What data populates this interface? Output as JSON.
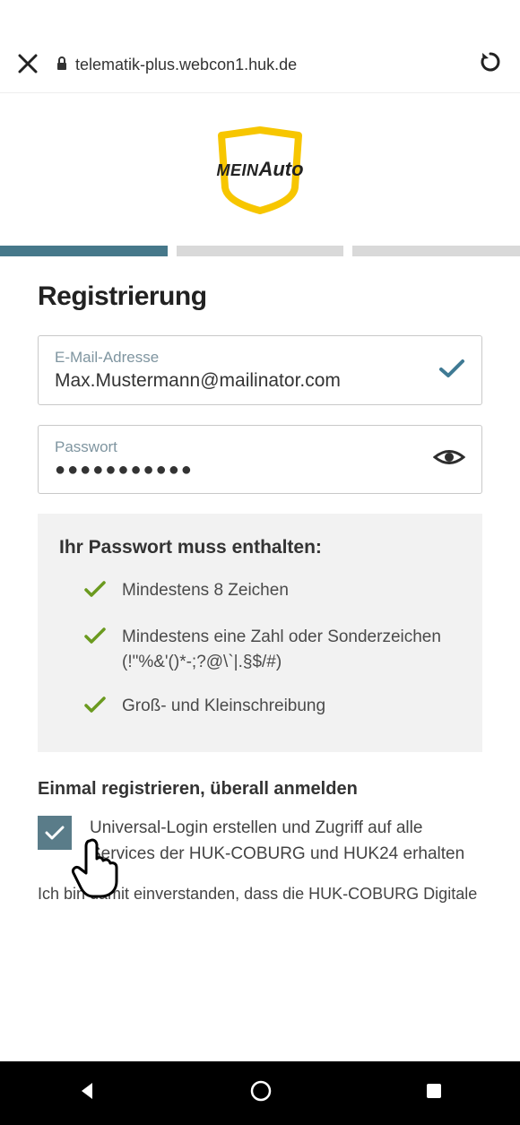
{
  "browser": {
    "url": "telematik-plus.webcon1.huk.de"
  },
  "logo": {
    "text1": "MEIN",
    "text2": "Auto"
  },
  "progress": {
    "current": 1,
    "total": 3
  },
  "title": "Registrierung",
  "email": {
    "label": "E-Mail-Adresse",
    "value": "Max.Mustermann@mailinator.com",
    "valid": true
  },
  "password": {
    "label": "Passwort",
    "masked_value": "●●●●●●●●●●●"
  },
  "rules": {
    "heading": "Ihr Passwort muss enthalten:",
    "items": [
      "Mindestens 8 Zeichen",
      "Mindestens eine Zahl oder Sonderzeichen (!\"%&'()*-;?@\\`|.§$/#)",
      "Groß- und Kleinschreibung"
    ]
  },
  "universal": {
    "heading": "Einmal registrieren, überall anmelden",
    "checkbox_label": "Universal-Login erstellen und Zugriff auf alle Services der HUK-COBURG und HUK24 erhalten",
    "checked": true
  },
  "consent_text": "Ich bin damit einverstanden, dass die HUK-COBURG Digitale"
}
